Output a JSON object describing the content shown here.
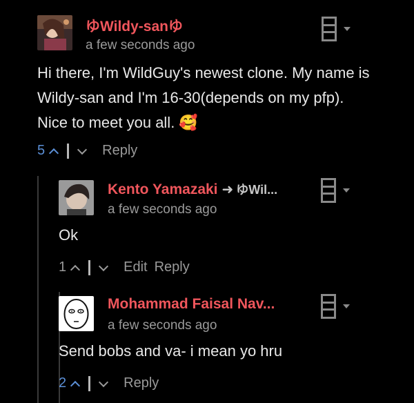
{
  "comments": [
    {
      "author": "ゆWildy-sanゆ",
      "time": "a few seconds ago",
      "text": "Hi there, I'm WildGuy's newest clone. My name is Wildy-san and I'm 16-30(depends on my pfp). Nice to meet you all. 🥰",
      "votes": "5",
      "actions": [
        "Reply"
      ]
    },
    {
      "author": "Kento Yamazaki",
      "reply_to": "ゆWil...",
      "time": "a few seconds ago",
      "text": "Ok",
      "votes": "1",
      "actions": [
        "Edit",
        "Reply"
      ]
    },
    {
      "author": "Mohammad Faisal Nav...",
      "time": "a few seconds ago",
      "text": "Send bobs and va- i mean yo hru",
      "votes": "2",
      "actions": [
        "Reply"
      ]
    }
  ]
}
